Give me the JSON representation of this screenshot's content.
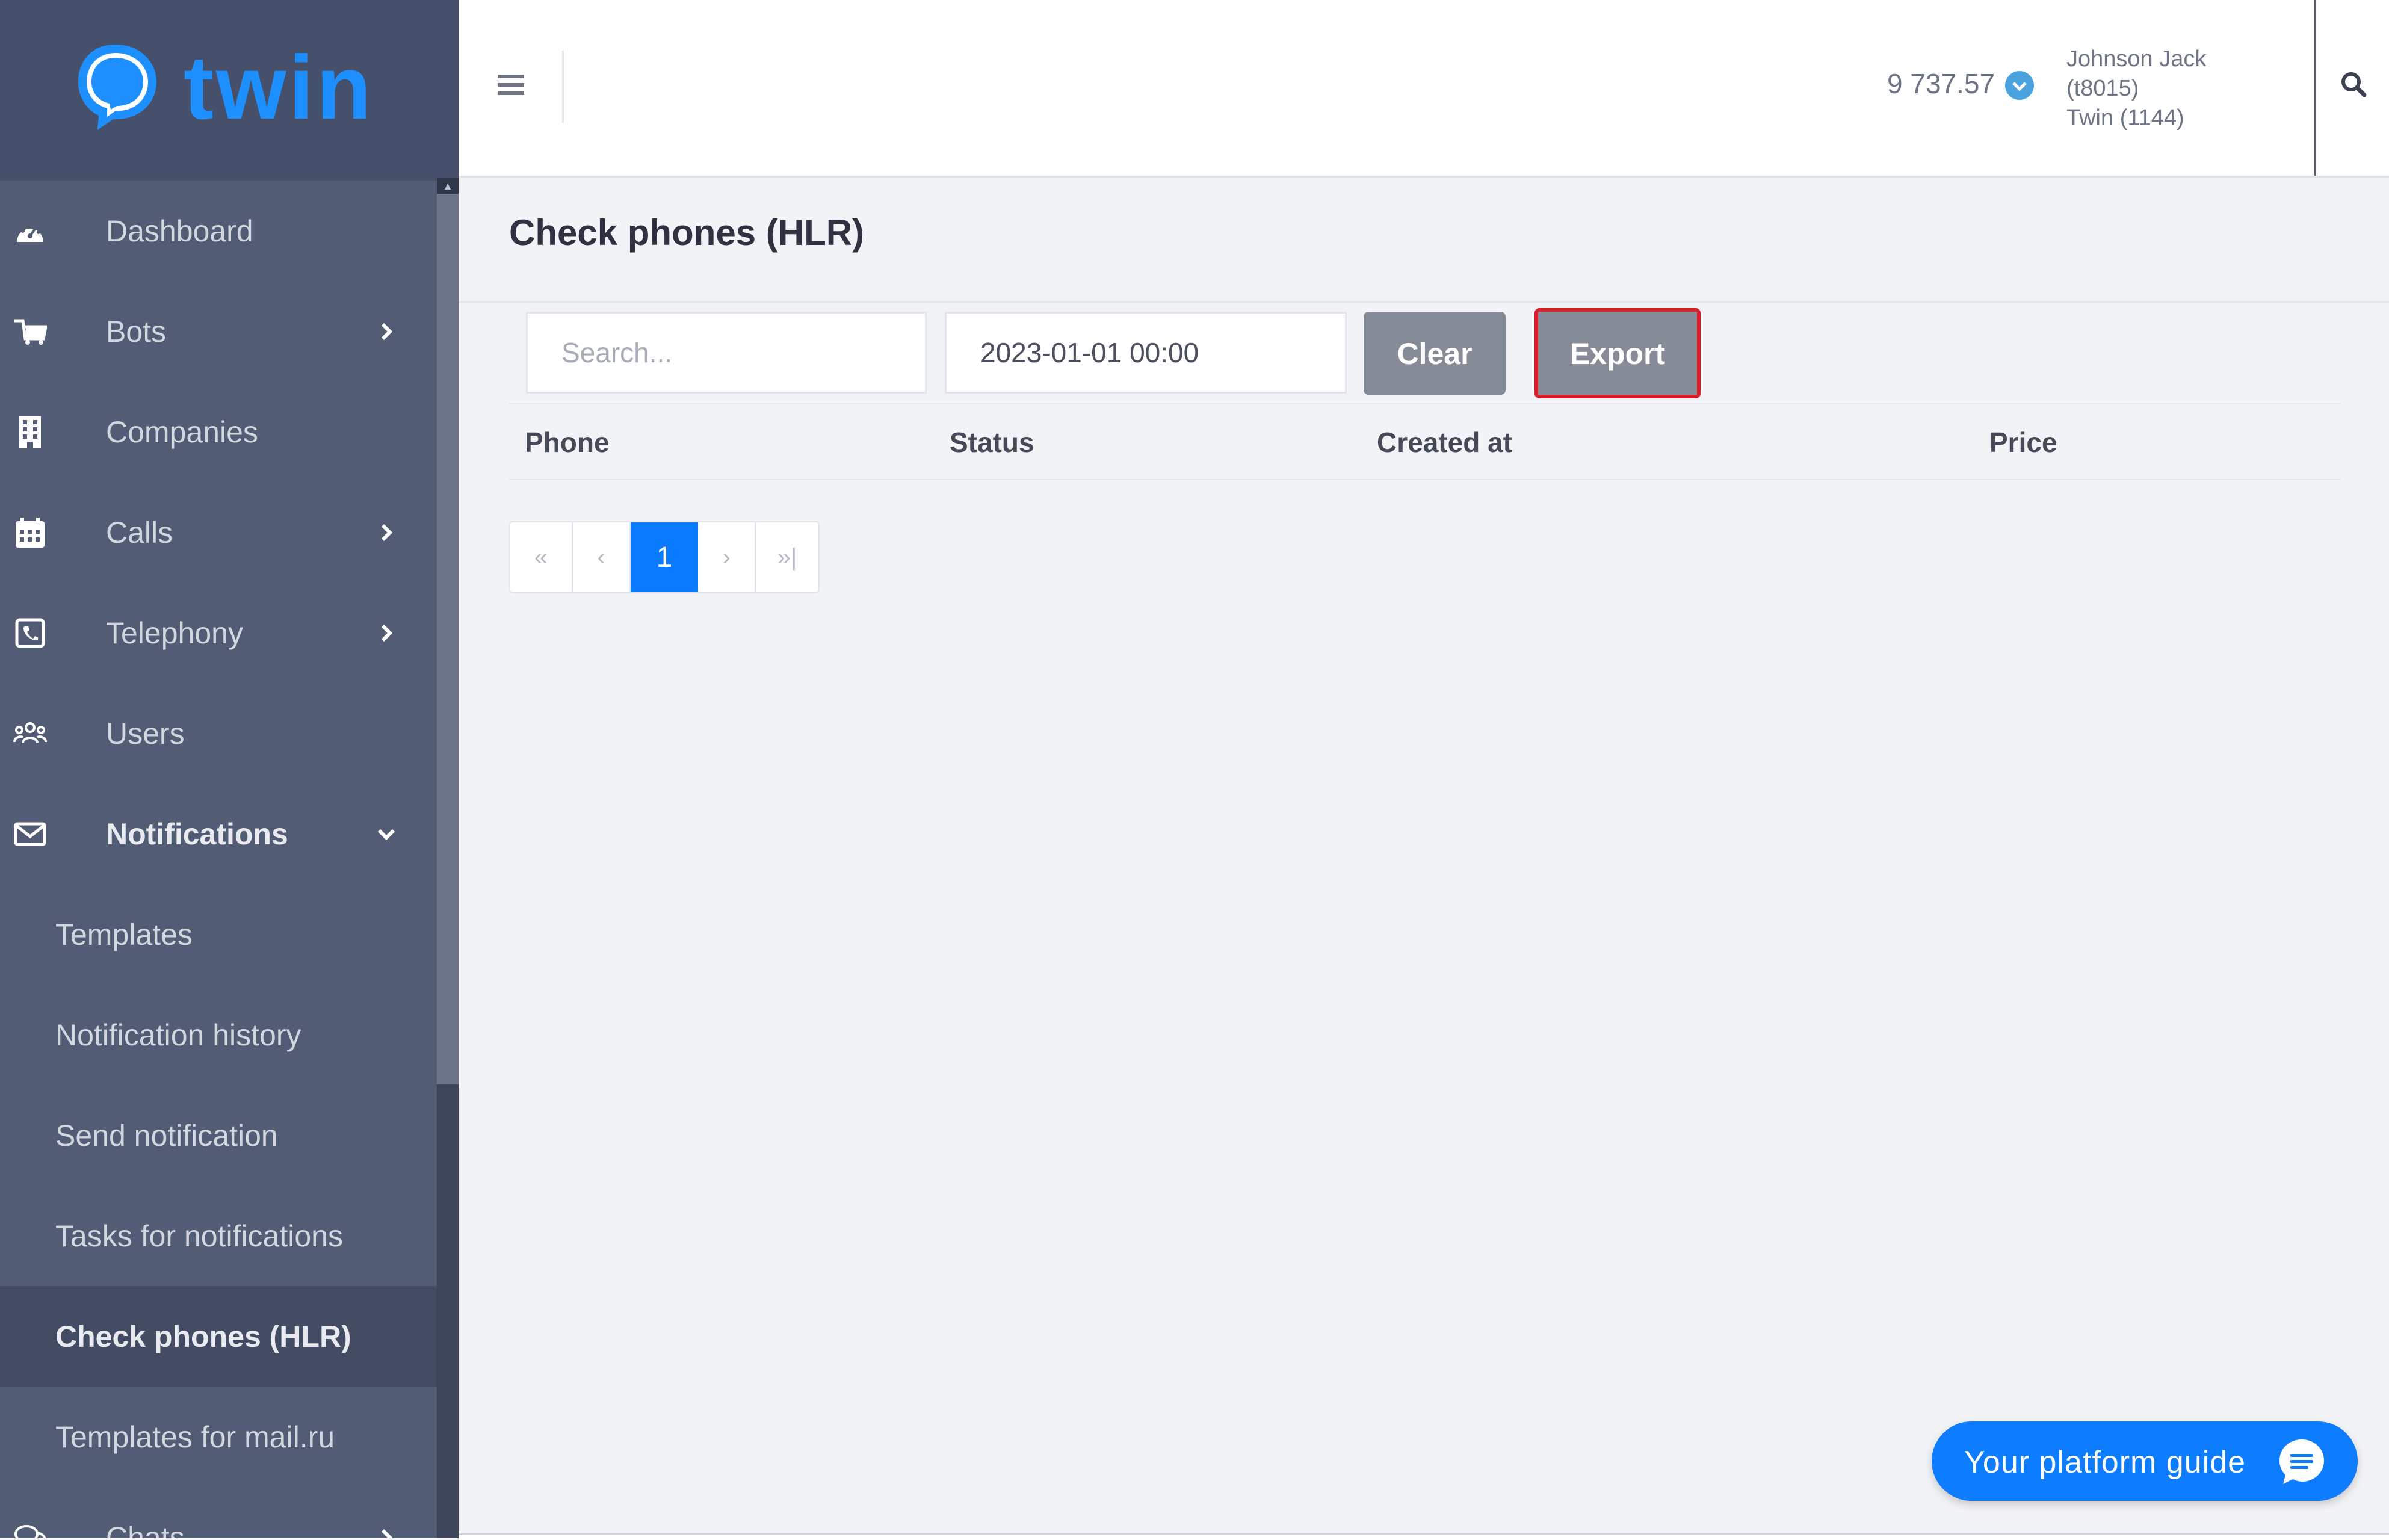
{
  "brand": {
    "name": "twin"
  },
  "sidebar": {
    "items": [
      {
        "label": "Dashboard",
        "icon": "dashboard-gauge-icon"
      },
      {
        "label": "Bots",
        "icon": "bots-icon",
        "has_children": true
      },
      {
        "label": "Companies",
        "icon": "building-icon"
      },
      {
        "label": "Calls",
        "icon": "calendar-icon",
        "has_children": true
      },
      {
        "label": "Telephony",
        "icon": "phone-square-icon",
        "has_children": true
      },
      {
        "label": "Users",
        "icon": "users-icon"
      },
      {
        "label": "Notifications",
        "icon": "envelope-icon",
        "has_children": true,
        "expanded": true
      }
    ],
    "notifications_sub": [
      {
        "label": "Templates"
      },
      {
        "label": "Notification history"
      },
      {
        "label": "Send notification"
      },
      {
        "label": "Tasks for notifications"
      },
      {
        "label": "Check phones (HLR)",
        "active": true
      },
      {
        "label": "Templates for mail.ru"
      }
    ],
    "after": [
      {
        "label": "Chats",
        "icon": "chats-icon",
        "has_children": true
      }
    ]
  },
  "header": {
    "balance": "9 737.57",
    "user_name": "Johnson Jack",
    "user_login": "(t8015)",
    "company": "Twin (1144)"
  },
  "page": {
    "title": "Check phones (HLR)"
  },
  "filters": {
    "search_placeholder": "Search...",
    "date_value": "2023-01-01 00:00",
    "clear_label": "Clear",
    "export_label": "Export"
  },
  "table": {
    "columns": [
      "Phone",
      "Status",
      "Created at",
      "Price"
    ],
    "rows": []
  },
  "pagination": {
    "first": "«",
    "prev": "‹",
    "current": "1",
    "next": "›",
    "last": "»|"
  },
  "guide": {
    "label": "Your platform guide"
  },
  "colors": {
    "sidebar_bg": "#525c74",
    "accent": "#0a7bff",
    "button_gray": "#858c97",
    "highlight_red": "#d9202a"
  }
}
